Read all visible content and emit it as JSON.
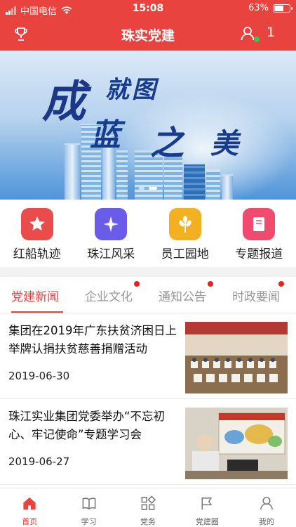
{
  "status": {
    "carrier": "中国电信",
    "time": "15:08",
    "battery": "63%",
    "battery_level": 0.63
  },
  "header": {
    "title": "珠实党建",
    "count": "1"
  },
  "banner": {
    "slogan": [
      "成",
      "就图",
      "蓝",
      "之",
      "美"
    ],
    "active_slide": 1,
    "slides": 2
  },
  "quick_links": [
    {
      "label": "红船轨迹",
      "color": "#ea4b4b",
      "icon": "star-icon"
    },
    {
      "label": "珠江风采",
      "color": "#6a5ce8",
      "icon": "compass-icon"
    },
    {
      "label": "员工园地",
      "color": "#f3b021",
      "icon": "wheat-icon"
    },
    {
      "label": "专题报道",
      "color": "#f04a6e",
      "icon": "book-icon"
    }
  ],
  "tabs": [
    {
      "label": "党建新闻",
      "active": true,
      "dot": false
    },
    {
      "label": "企业文化",
      "active": false,
      "dot": true
    },
    {
      "label": "通知公告",
      "active": false,
      "dot": true
    },
    {
      "label": "时政要闻",
      "active": false,
      "dot": true
    }
  ],
  "news": [
    {
      "title": "集团在2019年广东扶贫济困日上举牌认捐扶贫慈善捐赠活动",
      "date": "2019-06-30"
    },
    {
      "title": "珠江实业集团党委举办“不忘初心、牢记使命”专题学习会",
      "date": "2019-06-27"
    }
  ],
  "tabbar": [
    {
      "label": "首页",
      "active": true
    },
    {
      "label": "学习",
      "active": false
    },
    {
      "label": "党务",
      "active": false
    },
    {
      "label": "党建圈",
      "active": false
    },
    {
      "label": "我的",
      "active": false
    }
  ],
  "colors": {
    "brand": "#e8433f",
    "online": "#3cc451"
  }
}
